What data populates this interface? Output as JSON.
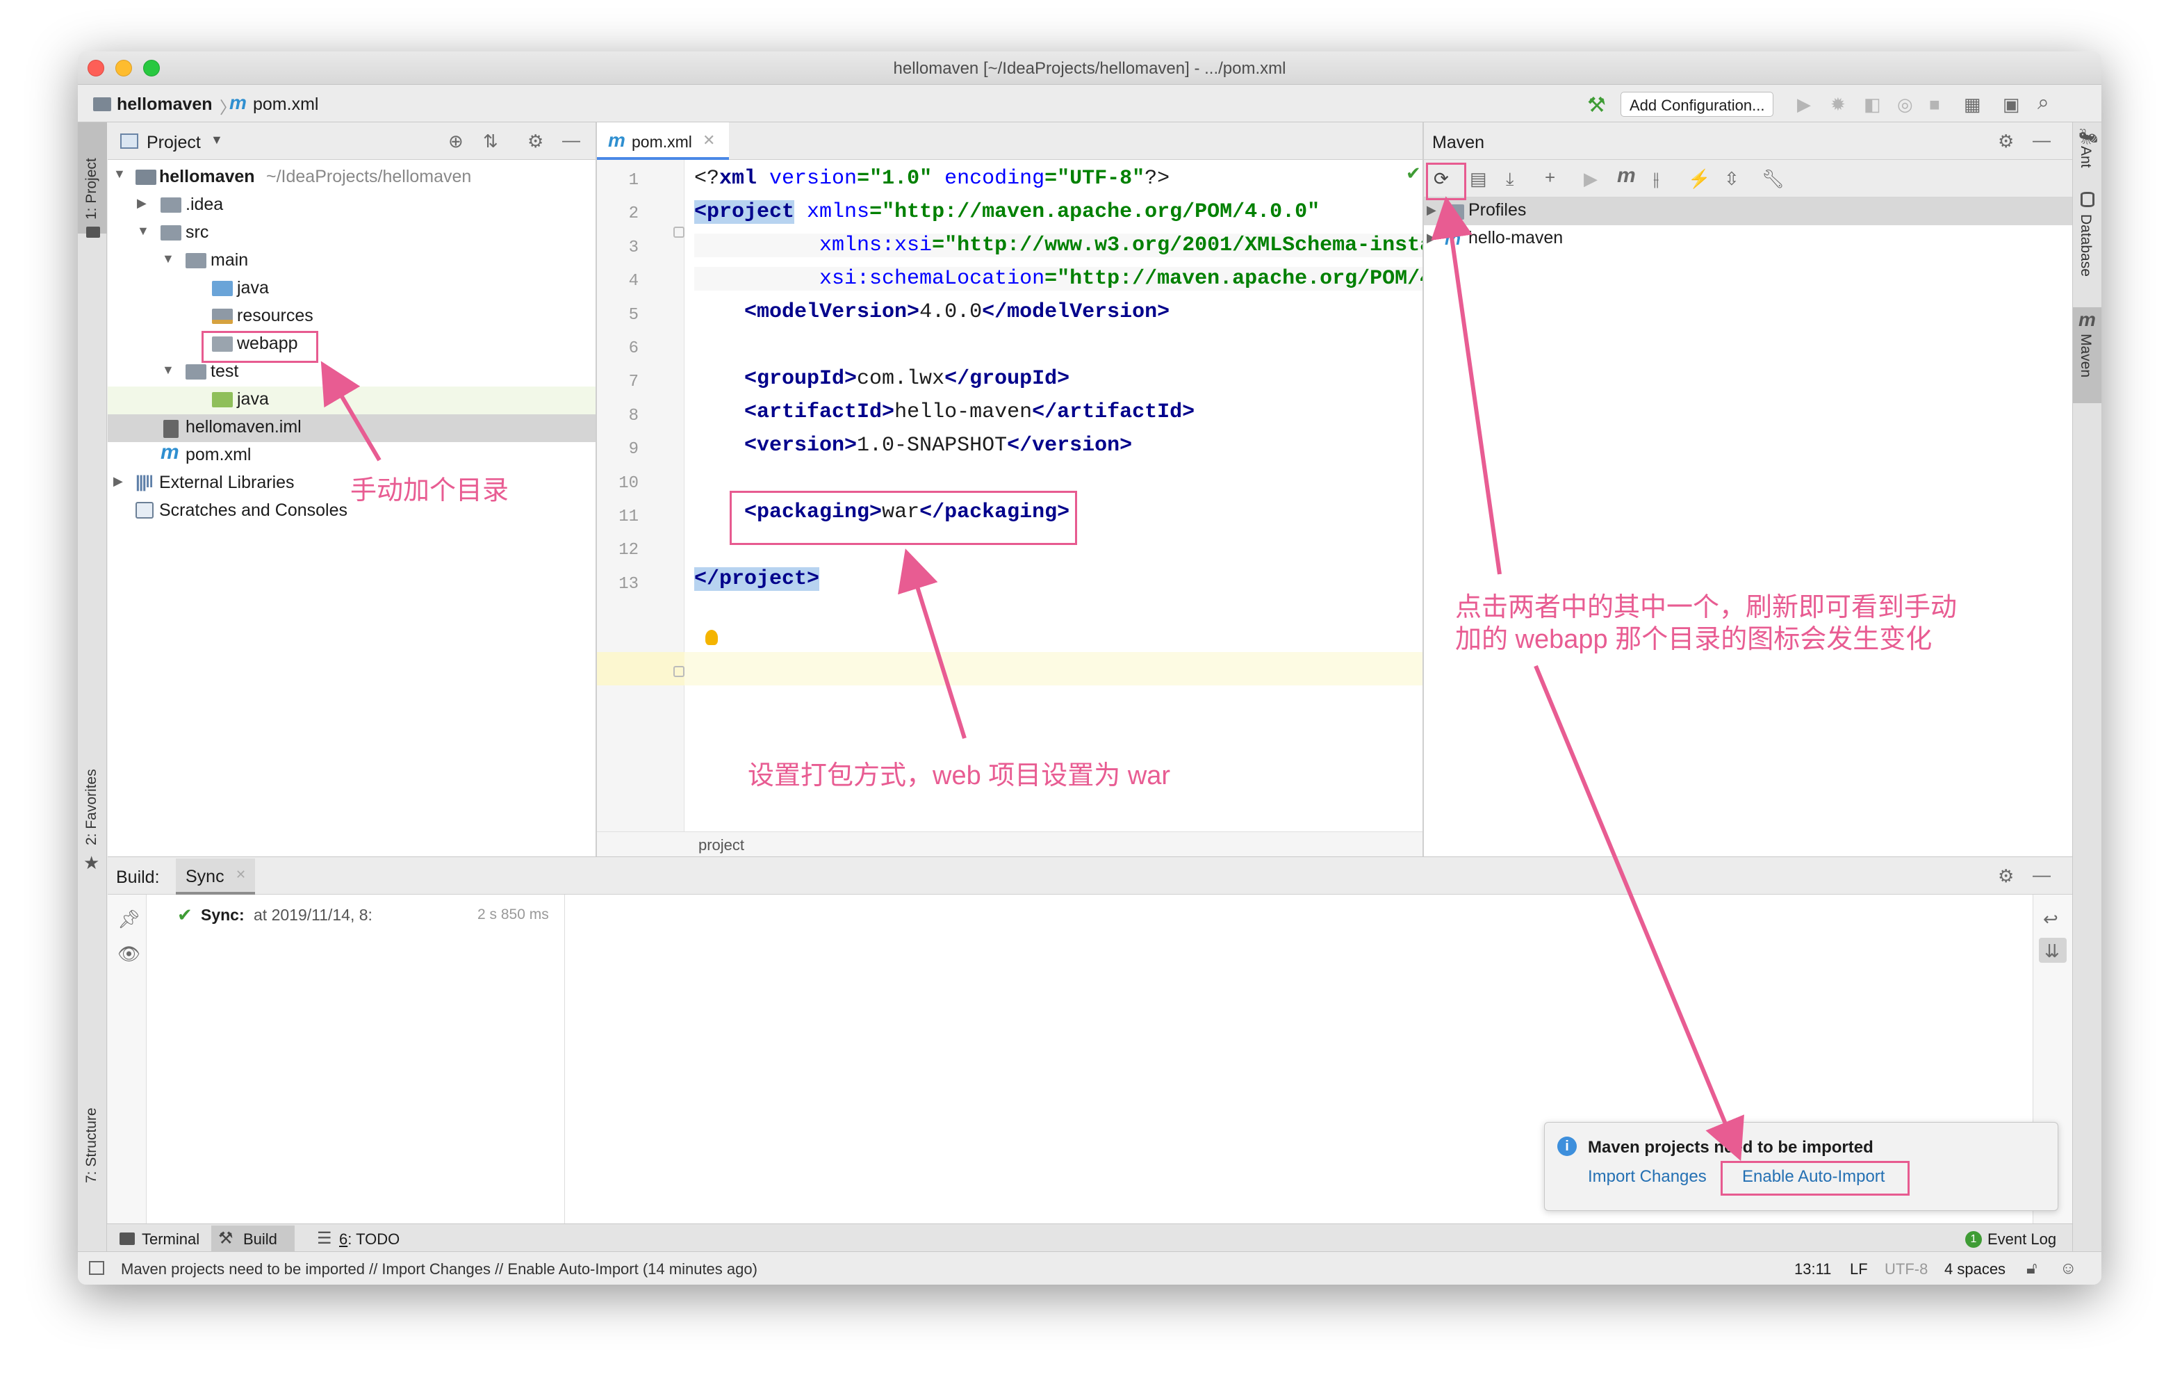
{
  "window": {
    "title": "hellomaven [~/IdeaProjects/hellomaven] - .../pom.xml"
  },
  "navbar": {
    "crumb_project": "hellomaven",
    "crumb_file": "pom.xml",
    "add_config": "Add Configuration..."
  },
  "left_strip": {
    "project_tab": "1: Project",
    "favorites_tab": "2: Favorites",
    "structure_tab": "7: Structure"
  },
  "right_strip": {
    "ant_tab": "Ant",
    "database_tab": "Database",
    "maven_tab": "Maven"
  },
  "project_panel": {
    "title": "Project",
    "root_name": "hellomaven",
    "root_path": "~/IdeaProjects/hellomaven",
    "tree": {
      "idea": ".idea",
      "src": "src",
      "main": "main",
      "java": "java",
      "resources": "resources",
      "webapp": "webapp",
      "test": "test",
      "test_java": "java",
      "iml": "hellomaven.iml",
      "pom": "pom.xml",
      "external": "External Libraries",
      "scratches": "Scratches and Consoles"
    }
  },
  "editor": {
    "tab_label": "pom.xml",
    "breadcrumb": "project",
    "line_numbers": [
      "1",
      "2",
      "3",
      "4",
      "5",
      "6",
      "7",
      "8",
      "9",
      "10",
      "11",
      "12",
      "13"
    ],
    "lines": {
      "l1_tag_open": "<?",
      "l1_name": "xml",
      "l1_a1": " version",
      "l1_v1": "=\"1.0\"",
      "l1_a2": " encoding",
      "l1_v2": "=\"UTF-8\"",
      "l1_close": "?>",
      "l2_tag": "<project",
      "l2_attr": " xmlns",
      "l2_val": "=\"http://maven.apache.org/POM/4.0.0\"",
      "l3_attr": "xmlns:xsi",
      "l3_val": "=\"http://www.w3.org/2001/XMLSchema-insta",
      "l4_attr": "xsi:schemaLocation",
      "l4_val": "=\"http://maven.apache.org/POM/4",
      "l5_open": "<modelVersion>",
      "l5_text": "4.0.0",
      "l5_close": "</modelVersion>",
      "l7_open": "<groupId>",
      "l7_text": "com.lwx",
      "l7_close": "</groupId>",
      "l8_open": "<artifactId>",
      "l8_text": "hello-maven",
      "l8_close": "</artifactId>",
      "l9_open": "<version>",
      "l9_text": "1.0-SNAPSHOT",
      "l9_close": "</version>",
      "l11_open": "<packaging>",
      "l11_text": "war",
      "l11_close": "</packaging>",
      "l13": "</project>"
    }
  },
  "maven_panel": {
    "title": "Maven",
    "profiles": "Profiles",
    "project": "hello-maven"
  },
  "build_panel": {
    "label": "Build:",
    "tab": "Sync",
    "sync_label": "Sync:",
    "sync_time": "at 2019/11/14, 8:",
    "sync_duration": "2 s 850 ms"
  },
  "notification": {
    "title": "Maven projects need to be imported",
    "import_changes": "Import Changes",
    "enable_auto": "Enable Auto-Import"
  },
  "tool_tabs": {
    "terminal": "Terminal",
    "build": "Build",
    "todo_key": "6",
    "todo": ": TODO",
    "event_log": "Event Log"
  },
  "status": {
    "message": "Maven projects need to be imported // Import Changes // Enable Auto-Import (14 minutes ago)",
    "position": "13:11",
    "line_sep": "LF",
    "encoding": "UTF-8",
    "indent": "4 spaces"
  },
  "annotations": {
    "manual_dir": "手动加个目录",
    "packaging": "设置打包方式，web 项目设置为 war",
    "refresh_line1": "点击两者中的其中一个，刷新即可看到手动",
    "refresh_line2": "加的 webapp 那个目录的图标会发生变化"
  },
  "colors": {
    "annotation": "#e85c92",
    "xml_tag": "#00008b",
    "xml_value": "#008000",
    "link": "#2470b3",
    "test_folder": "#8fbf5a",
    "source_folder": "#6aa4d8"
  }
}
